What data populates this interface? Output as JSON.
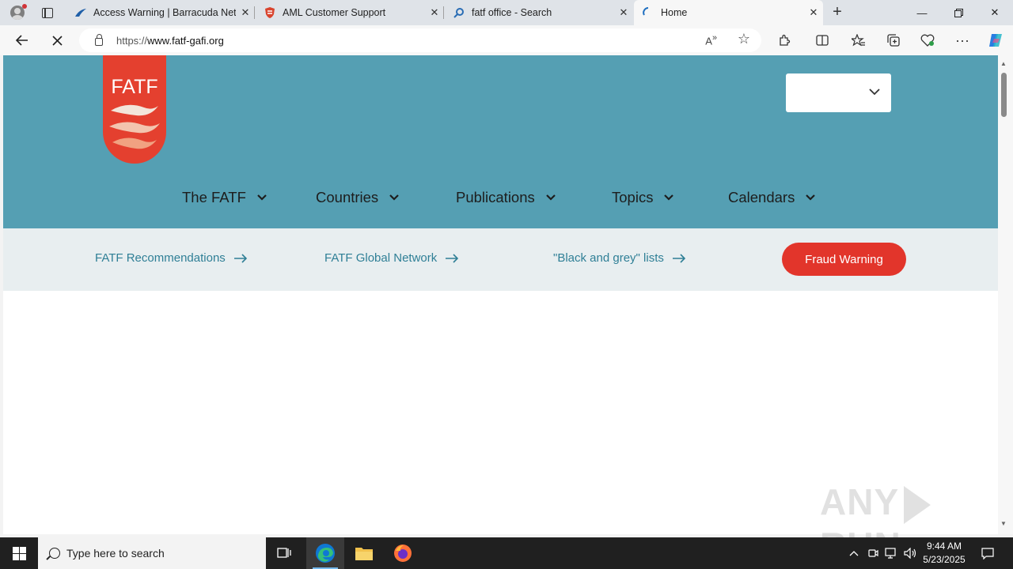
{
  "browser": {
    "tabs": [
      {
        "title": "Access Warning | Barracuda Netw",
        "icon": "barracuda-icon"
      },
      {
        "title": "AML Customer Support",
        "icon": "shield-icon"
      },
      {
        "title": "fatf office - Search",
        "icon": "search-icon"
      },
      {
        "title": "Home",
        "icon": "loading-icon"
      }
    ],
    "url_prefix": "https://",
    "url_host": "www.fatf-gafi.org"
  },
  "site": {
    "logo_text": "FATF",
    "nav": [
      {
        "label": "The FATF"
      },
      {
        "label": "Countries"
      },
      {
        "label": "Publications"
      },
      {
        "label": "Topics"
      },
      {
        "label": "Calendars"
      }
    ],
    "quick_links": [
      {
        "label": "FATF Recommendations"
      },
      {
        "label": "FATF Global Network"
      },
      {
        "label": "\"Black and grey\" lists"
      }
    ],
    "fraud_button": "Fraud Warning",
    "colors": {
      "header": "#559fb3",
      "accent": "#e2352b",
      "link": "#2f7f96"
    }
  },
  "watermark": {
    "left": "ANY",
    "right": "RUN"
  },
  "taskbar": {
    "search_placeholder": "Type here to search",
    "time": "9:44 AM",
    "date": "5/23/2025"
  }
}
